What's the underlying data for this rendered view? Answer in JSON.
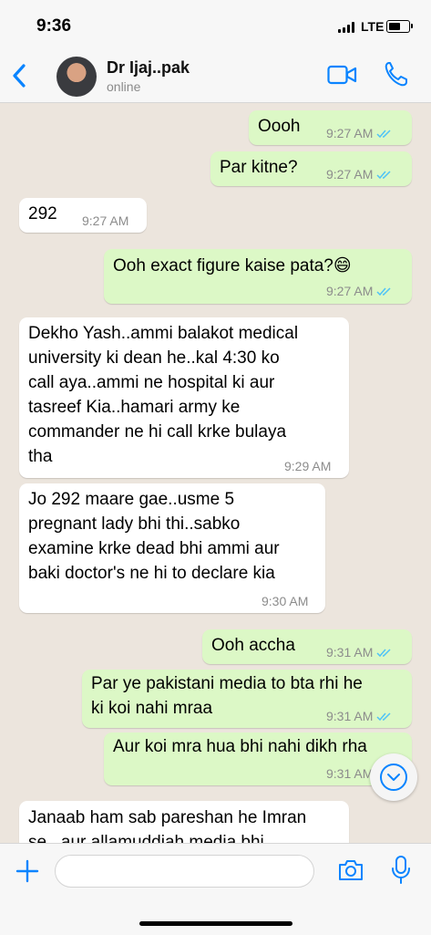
{
  "status_bar": {
    "time": "9:36",
    "network": "LTE"
  },
  "header": {
    "contact_name": "Dr Ijaj..pak",
    "contact_status": "online"
  },
  "messages": [
    {
      "text": "Oooh",
      "time": "9:27 AM"
    },
    {
      "text": "Par kitne?",
      "time": "9:27 AM"
    },
    {
      "text": "292",
      "time": "9:27 AM"
    },
    {
      "text": "Ooh exact figure kaise pata?😄",
      "time": "9:27 AM"
    },
    {
      "lines": [
        "Dekho Yash..ammi balakot medical",
        "university ki dean he..kal 4:30 ko",
        "call aya..ammi ne hospital ki aur",
        "tasreef Kia..hamari army ke",
        "commander ne hi call krke bulaya",
        "tha"
      ],
      "time": "9:29 AM"
    },
    {
      "lines": [
        "Jo 292 maare gae..usme 5",
        "pregnant lady bhi thi..sabko",
        "examine krke dead bhi ammi aur",
        "baki doctor's ne hi to declare kia"
      ],
      "time": "9:30 AM"
    },
    {
      "text": "Ooh accha",
      "time": "9:31 AM"
    },
    {
      "lines": [
        "Par ye pakistani media to bta rhi he",
        "ki koi nahi mraa"
      ],
      "time": "9:31 AM"
    },
    {
      "text": "Aur koi mra hua bhi nahi dikh rha",
      "time": "9:31 AM"
    },
    {
      "lines": [
        "Janaab ham sab pareshan he Imran",
        "se...aur allamuddiah media bhi"
      ]
    }
  ],
  "input": {
    "placeholder": ""
  },
  "colors": {
    "accent": "#0a84ff",
    "outgoing_bubble": "#dcf8c6",
    "incoming_bubble": "#ffffff",
    "read_ticks": "#4fc3f7"
  }
}
